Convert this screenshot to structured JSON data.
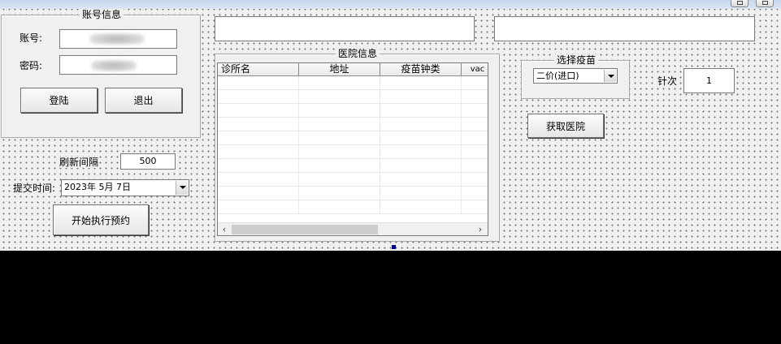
{
  "account_group": {
    "title": "账号信息",
    "account_label": "账号:",
    "account_value": "",
    "password_label": "密码:",
    "password_value": "",
    "login_label": "登陆",
    "logout_label": "退出"
  },
  "refresh": {
    "label": "刷新间隔",
    "value": "500"
  },
  "submit_time": {
    "label": "提交时间:",
    "value": "2023年  5月  7日"
  },
  "start_button_label": "开始执行预约",
  "hospital_group": {
    "title": "医院信息",
    "columns": [
      "诊所名",
      "地址",
      "疫苗钟类",
      "vac"
    ]
  },
  "vaccine_group": {
    "title": "选择疫苗",
    "selected": "二价(进口)"
  },
  "dose": {
    "label": "针次",
    "value": "1"
  },
  "get_hospital_label": "获取医院",
  "top_fields": {
    "left_value": "",
    "right_value": ""
  },
  "icons": {
    "combo_arrow": "chevron-down-icon",
    "scroll_left": "arrow-left-icon",
    "scroll_right": "arrow-right-icon"
  },
  "colors": {
    "form_background": "#f0f0f0",
    "selection_handle": "#000080",
    "outside_area": "#000000"
  }
}
